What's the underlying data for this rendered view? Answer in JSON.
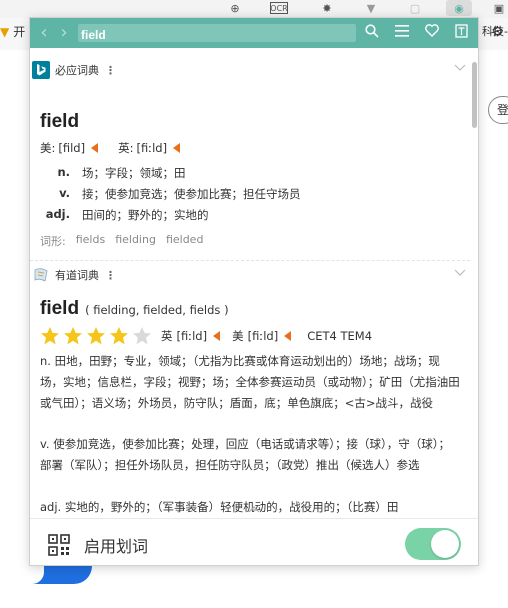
{
  "browser": {
    "bookmark_left": "开",
    "bookmark_right": "科技-",
    "side_button": "登",
    "ext_ocr_label": "OCR"
  },
  "popup": {
    "search": {
      "value": "field"
    },
    "bing": {
      "name": "必应词典",
      "word": "field",
      "us_label": "美:",
      "us_phonetic": "[fild]",
      "uk_label": "英:",
      "uk_phonetic": "[fiːld]",
      "definitions": [
        {
          "pos": "n.",
          "text": "场；字段；领域；田"
        },
        {
          "pos": "v.",
          "text": "接；使参加竞选；使参加比赛；担任守场员"
        },
        {
          "pos": "adj.",
          "text": "田间的；野外的；实地的"
        }
      ],
      "forms_label": "词形:",
      "forms": [
        "fields",
        "fielding",
        "fielded"
      ]
    },
    "youdao": {
      "name": "有道词典",
      "word": "field",
      "inflections": "( fielding, fielded, fields )",
      "star_rating": 4,
      "star_max": 5,
      "uk_label": "英",
      "uk_phonetic": "[fiːld]",
      "us_label": "美",
      "us_phonetic": "[fiːld]",
      "tags": "CET4 TEM4",
      "def_n": "n. 田地，田野；专业，领域；（尤指为比赛或体育运动划出的）场地；战场；现场，实地；信息栏，字段；视野；场；全体参赛运动员（或动物）；矿田（尤指油田或气田）；语义场；外场员，防守队；盾面，底；单色旗底；<古>战斗，战役",
      "def_v": "v. 使参加竞选，使参加比赛；处理，回应（电话或请求等）；接（球），守（球）；部署（军队）；担任外场队员，担任防守队员；（政党）推出（候选人）参选",
      "def_adj": "adj. 实地的，野外的；（军事装备）轻便机动的，战役用的；（比赛）田"
    },
    "bottom": {
      "label": "启用划词",
      "toggle_on": true
    }
  },
  "colors": {
    "topbar": "#5eb5a6",
    "toggle": "#7ad3a6",
    "speaker": "#e8701a",
    "star": "#f5c518",
    "star_empty": "#d9d9d9"
  }
}
